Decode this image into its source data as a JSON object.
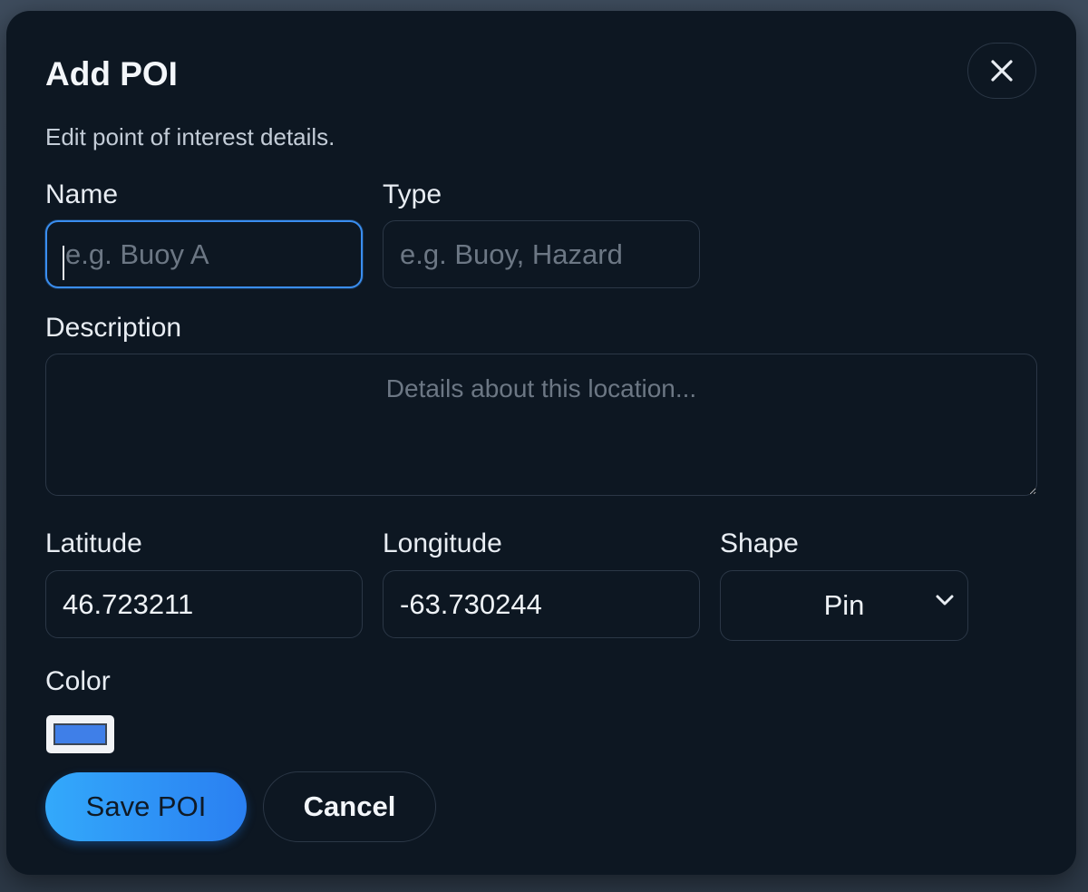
{
  "dialog": {
    "title": "Add POI",
    "subtitle": "Edit point of interest details.",
    "close_icon": "close-icon"
  },
  "form": {
    "name": {
      "label": "Name",
      "value": "",
      "placeholder": "e.g. Buoy A"
    },
    "type": {
      "label": "Type",
      "value": "",
      "placeholder": "e.g. Buoy, Hazard"
    },
    "description": {
      "label": "Description",
      "value": "",
      "placeholder": "Details about this location..."
    },
    "latitude": {
      "label": "Latitude",
      "value": "46.723211"
    },
    "longitude": {
      "label": "Longitude",
      "value": "-63.730244"
    },
    "shape": {
      "label": "Shape",
      "selected": "Pin",
      "icon": "chevron-down-icon"
    },
    "color": {
      "label": "Color",
      "value": "#3f7fe8"
    }
  },
  "actions": {
    "save_label": "Save POI",
    "cancel_label": "Cancel"
  },
  "colors": {
    "dialog_bg": "#0d1722",
    "accent": "#3a8ef0",
    "primary_gradient_start": "#33a9fb",
    "primary_gradient_end": "#2a7ff1"
  }
}
